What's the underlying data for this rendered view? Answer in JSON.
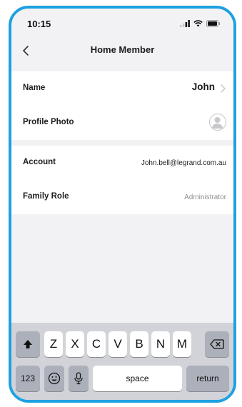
{
  "status_bar": {
    "time": "10:15"
  },
  "nav": {
    "title": "Home Member"
  },
  "profile": {
    "name_label": "Name",
    "name_value": "John",
    "photo_label": "Profile Photo"
  },
  "account": {
    "account_label": "Account",
    "account_value": "John.bell@legrand.com.au",
    "role_label": "Family Role",
    "role_value": "Administrator"
  },
  "keyboard": {
    "letters": [
      "Z",
      "X",
      "C",
      "V",
      "B",
      "N",
      "M"
    ],
    "numbers_key": "123",
    "space_key": "space",
    "return_key": "return"
  },
  "colors": {
    "frame": "#1da1e0",
    "background": "#f2f2f4",
    "keyboard": "#d1d3d9"
  },
  "icons": [
    "back-chevron-icon",
    "chevron-right-icon",
    "avatar-placeholder-icon",
    "shift-icon",
    "delete-icon",
    "emoji-icon",
    "microphone-icon",
    "signal-icon",
    "wifi-icon",
    "battery-icon"
  ]
}
